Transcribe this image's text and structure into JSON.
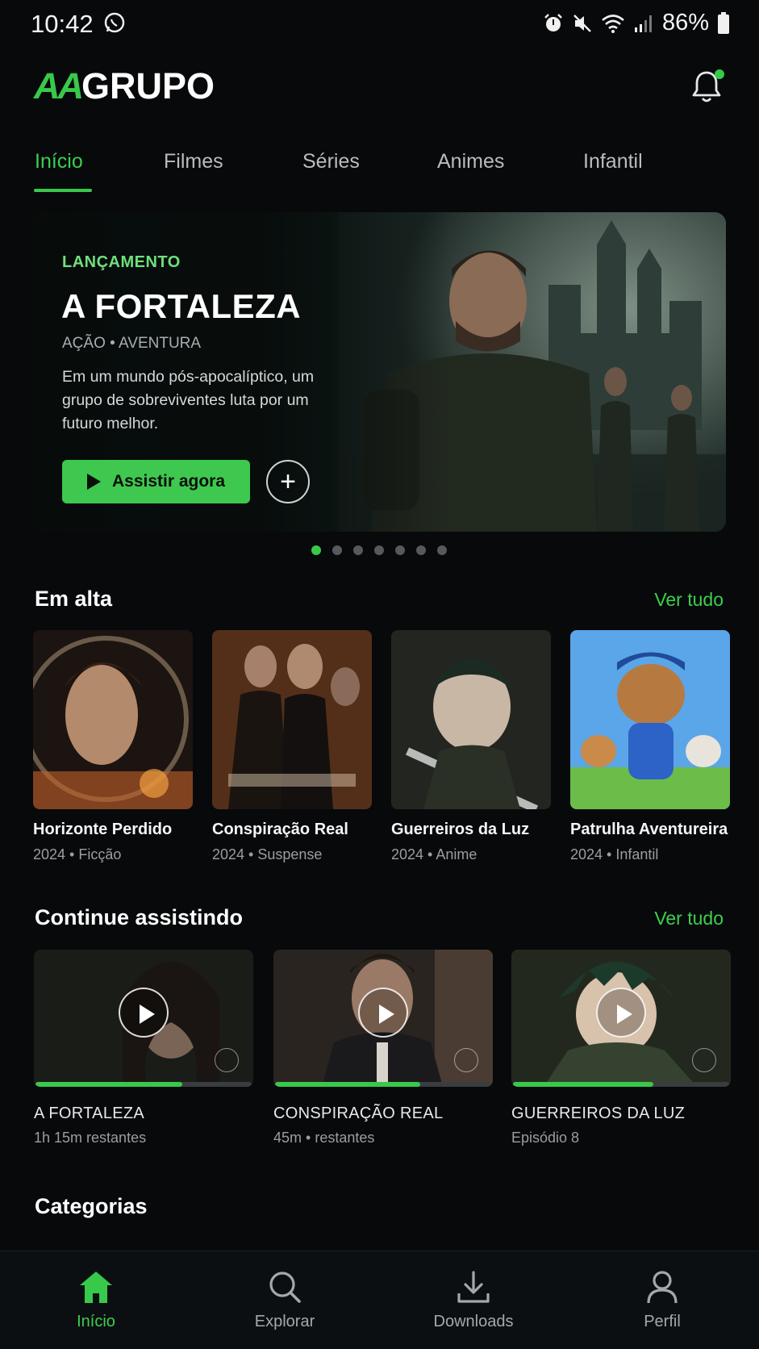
{
  "status_bar": {
    "time": "10:42",
    "battery": "86%",
    "icons": [
      "whatsapp-icon",
      "alarm-icon",
      "mute-icon",
      "wifi-icon",
      "signal-icon",
      "battery-icon"
    ]
  },
  "header": {
    "logo_aa": "AA",
    "logo_grupo": "GRUPO",
    "notification_icon": "bell-icon",
    "has_unread": true
  },
  "tabs": [
    {
      "label": "Início",
      "active": true
    },
    {
      "label": "Filmes",
      "active": false
    },
    {
      "label": "Séries",
      "active": false
    },
    {
      "label": "Animes",
      "active": false
    },
    {
      "label": "Infantil",
      "active": false
    }
  ],
  "hero": {
    "tag": "LANÇAMENTO",
    "title": "A FORTALEZA",
    "genres": "AÇÃO • AVENTURA",
    "description": "Em um mundo pós-apocalíptico, um grupo de sobreviventes luta por um futuro melhor.",
    "play_label": "Assistir agora",
    "add_label": "+",
    "carousel_count": 7,
    "carousel_active": 0
  },
  "trending": {
    "title": "Em alta",
    "see_all": "Ver tudo",
    "items": [
      {
        "title": "Horizonte Perdido",
        "meta": "2024 • Ficção"
      },
      {
        "title": "Conspiração Real",
        "meta": "2024 • Suspense"
      },
      {
        "title": "Guerreiros da Luz",
        "meta": "2024 • Anime"
      },
      {
        "title": "Patrulha Aventureira",
        "meta": "2024 • Infantil"
      }
    ]
  },
  "continue": {
    "title": "Continue assistindo",
    "see_all": "Ver tudo",
    "items": [
      {
        "title": "A FORTALEZA",
        "meta": "1h 15m restantes",
        "progress": 0.68
      },
      {
        "title": "CONSPIRAÇÃO REAL",
        "meta": "45m • restantes",
        "progress": 0.67
      },
      {
        "title": "GUERREIROS DA LUZ",
        "meta": "Episódio 8",
        "progress": 0.65
      }
    ]
  },
  "categories": {
    "title": "Categorias"
  },
  "bottom_nav": [
    {
      "label": "Início",
      "icon": "home-icon",
      "active": true
    },
    {
      "label": "Explorar",
      "icon": "search-icon",
      "active": false
    },
    {
      "label": "Downloads",
      "icon": "download-icon",
      "active": false
    },
    {
      "label": "Perfil",
      "icon": "profile-icon",
      "active": false
    }
  ],
  "colors": {
    "accent": "#38c94a",
    "background": "#07090b"
  }
}
